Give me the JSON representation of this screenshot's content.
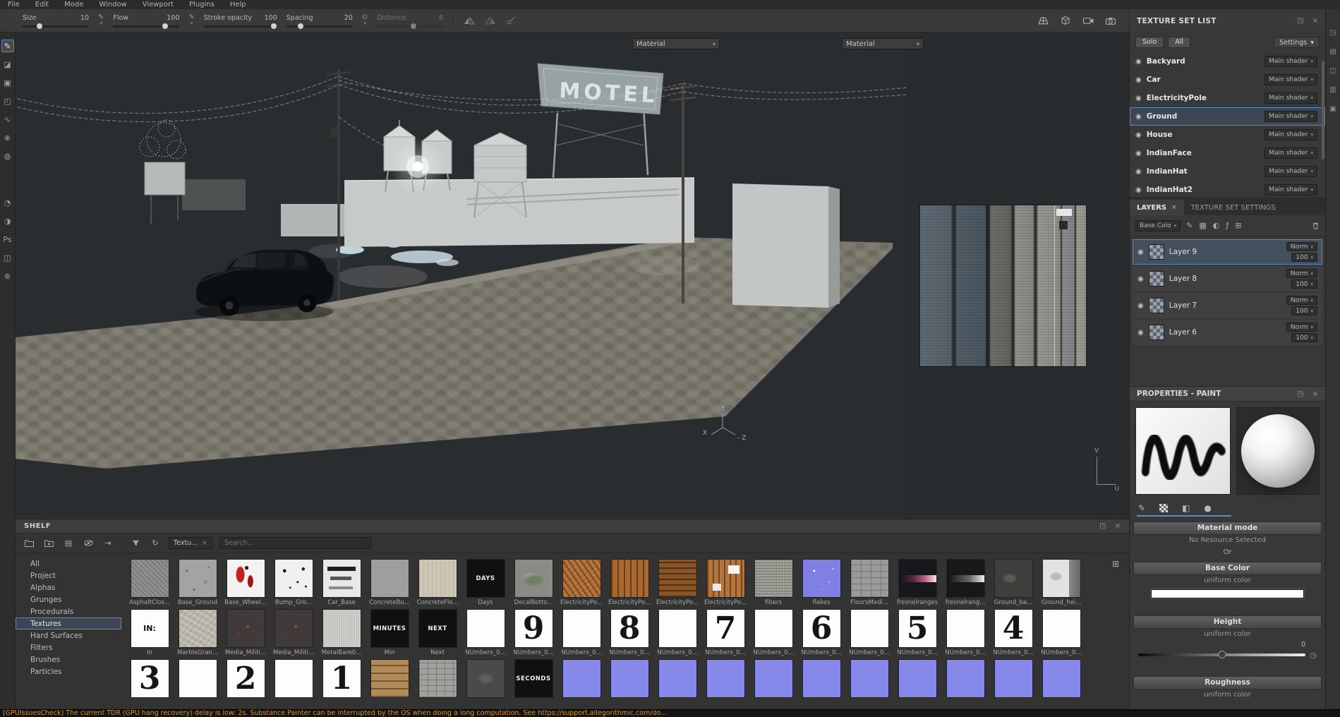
{
  "menubar": {
    "items": [
      "File",
      "Edit",
      "Mode",
      "Window",
      "Viewport",
      "Plugins",
      "Help"
    ]
  },
  "toolbar": {
    "size": {
      "label": "Size",
      "value": "10"
    },
    "flow": {
      "label": "Flow",
      "value": "100"
    },
    "stroke_opacity": {
      "label": "Stroke opacity",
      "value": "100"
    },
    "spacing": {
      "label": "Spacing",
      "value": "20"
    },
    "distance": {
      "label": "Distance",
      "value": "8"
    }
  },
  "left_tools": [
    {
      "name": "paint-tool",
      "glyph": "✎",
      "state": "selected"
    },
    {
      "name": "eraser-tool",
      "glyph": "◪",
      "state": ""
    },
    {
      "name": "projection-tool",
      "glyph": "▣",
      "state": ""
    },
    {
      "name": "polygon-fill-tool",
      "glyph": "◰",
      "state": ""
    },
    {
      "name": "smudge-tool",
      "glyph": "∿",
      "state": ""
    },
    {
      "name": "clone-tool",
      "glyph": "⊕",
      "state": ""
    },
    {
      "name": "material-picker-tool",
      "glyph": "◍",
      "state": ""
    }
  ],
  "left_tools_lower": [
    {
      "name": "quick-mask-tool",
      "glyph": "◔",
      "state": ""
    },
    {
      "name": "symmetry-tool",
      "glyph": "◑",
      "state": ""
    },
    {
      "name": "photoshop-plugin",
      "glyph": "Ps",
      "state": ""
    },
    {
      "name": "display-settings",
      "glyph": "◫",
      "state": ""
    },
    {
      "name": "render-mode",
      "glyph": "⊛",
      "state": ""
    }
  ],
  "viewport": {
    "material_3d": "Material",
    "material_2d": "Material",
    "motel_text": "MOTEL",
    "axis_3d": {
      "y": "Y",
      "x": "X",
      "z": "- Z"
    },
    "axis_2d": {
      "v": "V",
      "u": "U"
    }
  },
  "texture_set_list": {
    "title": "TEXTURE SET LIST",
    "solo_label": "Solo",
    "all_label": "All",
    "settings_label": "Settings",
    "sets": [
      {
        "name": "Backyard",
        "shader": "Main shader",
        "state": ""
      },
      {
        "name": "Car",
        "shader": "Main shader",
        "state": ""
      },
      {
        "name": "ElectricityPole",
        "shader": "Main shader",
        "state": ""
      },
      {
        "name": "Ground",
        "shader": "Main shader",
        "state": "selected"
      },
      {
        "name": "House",
        "shader": "Main shader",
        "state": ""
      },
      {
        "name": "IndianFace",
        "shader": "Main shader",
        "state": ""
      },
      {
        "name": "IndianHat",
        "shader": "Main shader",
        "state": ""
      },
      {
        "name": "IndianHat2",
        "shader": "Main shader",
        "state": ""
      }
    ]
  },
  "layers_panel": {
    "tab_layers": "LAYERS",
    "tab_settings": "TEXTURE SET SETTINGS",
    "channel_filter": "Base Colo",
    "layers": [
      {
        "name": "Layer 9",
        "blend": "Norm",
        "opacity": "100",
        "state": "selected"
      },
      {
        "name": "Layer 8",
        "blend": "Norm",
        "opacity": "100",
        "state": ""
      },
      {
        "name": "Layer 7",
        "blend": "Norm",
        "opacity": "100",
        "state": ""
      },
      {
        "name": "Layer 6",
        "blend": "Norm",
        "opacity": "100",
        "state": ""
      }
    ]
  },
  "properties": {
    "title": "PROPERTIES - PAINT",
    "material_mode_label": "Material mode",
    "no_resource_label": "No Resource Selected",
    "or_label": "Or",
    "base_color_label": "Base Color",
    "height_label": "Height",
    "roughness_label": "Roughness",
    "uniform_color_label": "uniform color",
    "height_value": "0"
  },
  "shelf": {
    "title": "SHELF",
    "filter_chip": "Textu...",
    "search_placeholder": "Search...",
    "categories": [
      {
        "label": "All",
        "state": ""
      },
      {
        "label": "Project",
        "state": ""
      },
      {
        "label": "Alphas",
        "state": ""
      },
      {
        "label": "Grunges",
        "state": ""
      },
      {
        "label": "Procedurals",
        "state": ""
      },
      {
        "label": "Textures",
        "state": "selected"
      },
      {
        "label": "Hard Surfaces",
        "state": ""
      },
      {
        "label": "Filters",
        "state": ""
      },
      {
        "label": "Brushes",
        "state": ""
      },
      {
        "label": "Particles",
        "state": ""
      }
    ],
    "rows": [
      [
        {
          "label": "AsphaltClos...",
          "cls": "t-asphalt",
          "text": ""
        },
        {
          "label": "Base_Ground",
          "cls": "t-baseground",
          "text": ""
        },
        {
          "label": "Base_Wheel...",
          "cls": "t-basewheel",
          "text": ""
        },
        {
          "label": "Bump_Gro...",
          "cls": "t-bump",
          "text": ""
        },
        {
          "label": "Car_Base",
          "cls": "t-carbase",
          "text": ""
        },
        {
          "label": "ConcreteBu...",
          "cls": "t-concrete1",
          "text": ""
        },
        {
          "label": "ConcreteFlo...",
          "cls": "t-concrete2",
          "text": ""
        },
        {
          "label": "Days",
          "cls": "t-black",
          "text": "DAYS"
        },
        {
          "label": "DecalBotto...",
          "cls": "t-decal",
          "text": ""
        },
        {
          "label": "ElectricityPo...",
          "cls": "t-wood-a",
          "text": ""
        },
        {
          "label": "ElectricityPo...",
          "cls": "t-wood-b",
          "text": ""
        },
        {
          "label": "ElectricityPo...",
          "cls": "t-wood-c",
          "text": ""
        },
        {
          "label": "ElectricityPo...",
          "cls": "t-wood-d",
          "text": ""
        },
        {
          "label": "fibers",
          "cls": "t-fibers",
          "text": ""
        },
        {
          "label": "flakes",
          "cls": "t-flakes",
          "text": ""
        },
        {
          "label": "FloorsMedi...",
          "cls": "t-floors",
          "text": ""
        },
        {
          "label": "fresnelranges",
          "cls": "t-fresnel1",
          "text": ""
        },
        {
          "label": "fresnelrang...",
          "cls": "t-fresnel2",
          "text": ""
        },
        {
          "label": "Ground_ba...",
          "cls": "t-groundba",
          "text": ""
        },
        {
          "label": "Ground_hei...",
          "cls": "t-groundhei",
          "text": ""
        }
      ],
      [
        {
          "label": "In",
          "cls": "t-whitetext",
          "text": "IN:"
        },
        {
          "label": "MarbleGran...",
          "cls": "t-marble",
          "text": ""
        },
        {
          "label": "Media_Militi...",
          "cls": "t-media",
          "text": ""
        },
        {
          "label": "Media_Militi...",
          "cls": "t-media",
          "text": ""
        },
        {
          "label": "MetalBare0...",
          "cls": "t-metal",
          "text": ""
        },
        {
          "label": "Min",
          "cls": "t-black",
          "text": "MINUTES"
        },
        {
          "label": "Next",
          "cls": "t-black",
          "text": "NEXT"
        },
        {
          "label": "NUmbers_0...",
          "cls": "t-white",
          "text": ""
        },
        {
          "label": "NUmbers_0...",
          "cls": "t-digit",
          "text": "9"
        },
        {
          "label": "NUmbers_0...",
          "cls": "t-white",
          "text": ""
        },
        {
          "label": "NUmbers_0...",
          "cls": "t-digit",
          "text": "8"
        },
        {
          "label": "NUmbers_0...",
          "cls": "t-white",
          "text": ""
        },
        {
          "label": "NUmbers_0...",
          "cls": "t-digit",
          "text": "7"
        },
        {
          "label": "NUmbers_0...",
          "cls": "t-white",
          "text": ""
        },
        {
          "label": "NUmbers_0...",
          "cls": "t-digit",
          "text": "6"
        },
        {
          "label": "NUmbers_0...",
          "cls": "t-white",
          "text": ""
        },
        {
          "label": "NUmbers_0...",
          "cls": "t-digit",
          "text": "5"
        },
        {
          "label": "NUmbers_0...",
          "cls": "t-white",
          "text": ""
        },
        {
          "label": "NUmbers_0...",
          "cls": "t-digit",
          "text": "4"
        },
        {
          "label": "NUmbers_0...",
          "cls": "t-white",
          "text": ""
        }
      ],
      [
        {
          "label": "",
          "cls": "t-digit",
          "text": "3"
        },
        {
          "label": "",
          "cls": "t-white",
          "text": ""
        },
        {
          "label": "",
          "cls": "t-digit",
          "text": "2"
        },
        {
          "label": "",
          "cls": "t-white",
          "text": ""
        },
        {
          "label": "",
          "cls": "t-digit",
          "text": "1"
        },
        {
          "label": "",
          "cls": "t-plank",
          "text": ""
        },
        {
          "label": "",
          "cls": "t-brick2",
          "text": ""
        },
        {
          "label": "",
          "cls": "t-dark",
          "text": ""
        },
        {
          "label": "",
          "cls": "t-black",
          "text": "SECONDS"
        },
        {
          "label": "",
          "cls": "t-purple",
          "text": ""
        },
        {
          "label": "",
          "cls": "t-purple",
          "text": ""
        },
        {
          "label": "",
          "cls": "t-purple",
          "text": ""
        },
        {
          "label": "",
          "cls": "t-purple",
          "text": ""
        },
        {
          "label": "",
          "cls": "t-purple",
          "text": ""
        },
        {
          "label": "",
          "cls": "t-purple",
          "text": ""
        },
        {
          "label": "",
          "cls": "t-purple",
          "text": ""
        },
        {
          "label": "",
          "cls": "t-purple",
          "text": ""
        },
        {
          "label": "",
          "cls": "t-purple",
          "text": ""
        },
        {
          "label": "",
          "cls": "t-purple",
          "text": ""
        },
        {
          "label": "",
          "cls": "t-purple",
          "text": ""
        }
      ]
    ]
  },
  "right_strip_icons": [
    {
      "name": "texture-set-list-panel-toggle",
      "glyph": "◳"
    },
    {
      "name": "layers-panel-toggle",
      "glyph": "▤"
    },
    {
      "name": "properties-panel-toggle",
      "glyph": "◫"
    },
    {
      "name": "shelf-panel-toggle",
      "glyph": "▥"
    },
    {
      "name": "log-panel-toggle",
      "glyph": "▣"
    }
  ],
  "statusbar": {
    "message": "[GPUIssuesCheck] The current TDR (GPU hang recovery) delay is low: 2s. Substance Painter can be interrupted by the OS when doing a long computation. See https://support.allegorithmic.com/do..."
  },
  "colors": {
    "accent": "#4f8fd0",
    "warning": "#d9932f"
  }
}
